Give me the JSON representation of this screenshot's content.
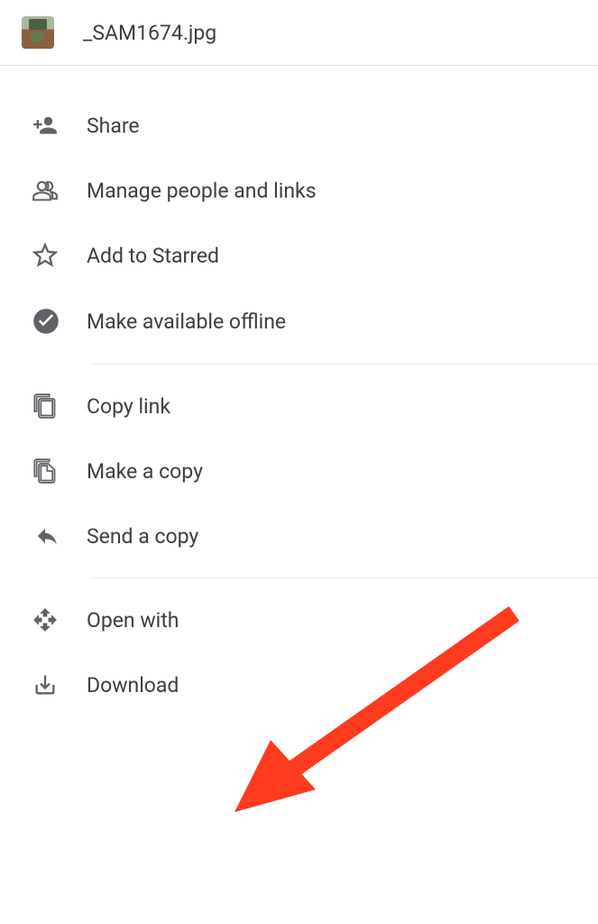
{
  "header": {
    "filename": "_SAM1674.jpg"
  },
  "menu": {
    "share": "Share",
    "manage": "Manage people and links",
    "star": "Add to Starred",
    "offline": "Make available offline",
    "copyLink": "Copy link",
    "makeCopy": "Make a copy",
    "sendCopy": "Send a copy",
    "openWith": "Open with",
    "download": "Download"
  },
  "annotation": {
    "arrow_color": "#ff3b1f",
    "target": "open-with-item"
  }
}
